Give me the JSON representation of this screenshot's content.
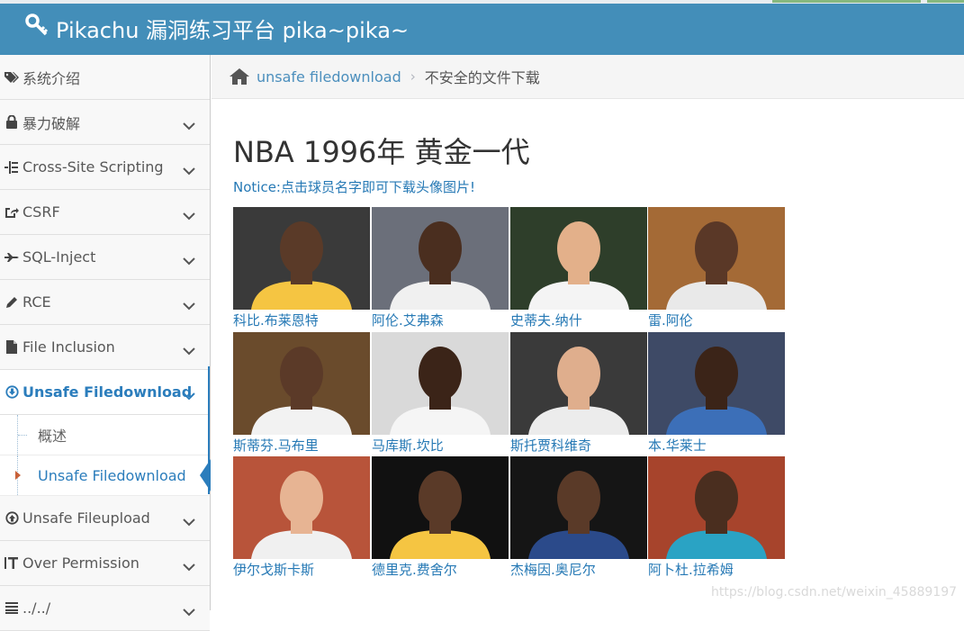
{
  "header": {
    "title": "Pikachu 漏洞练习平台 pika~pika~"
  },
  "sidebar": {
    "items": [
      {
        "label": "系统介绍",
        "icon": "tags-icon",
        "chevron": false
      },
      {
        "label": "暴力破解",
        "icon": "lock-icon",
        "chevron": true
      },
      {
        "label": "Cross-Site Scripting",
        "icon": "sitemap-icon",
        "chevron": true
      },
      {
        "label": "CSRF",
        "icon": "share-square-icon",
        "chevron": true
      },
      {
        "label": "SQL-Inject",
        "icon": "fighter-jet-icon",
        "chevron": true
      },
      {
        "label": "RCE",
        "icon": "pencil-icon",
        "chevron": true
      },
      {
        "label": "File Inclusion",
        "icon": "file-icon",
        "chevron": true
      },
      {
        "label": "Unsafe Filedownload",
        "icon": "download-circle-icon",
        "chevron": true
      },
      {
        "label": "Unsafe Fileupload",
        "icon": "upload-circle-icon",
        "chevron": true
      },
      {
        "label": "Over Permission",
        "icon": "text-height-icon",
        "chevron": true
      },
      {
        "label": "../../",
        "icon": "align-justify-icon",
        "chevron": true
      }
    ],
    "subitems": [
      {
        "label": "概述"
      },
      {
        "label": "Unsafe Filedownload"
      }
    ]
  },
  "breadcrumb": {
    "link": "unsafe filedownload",
    "current": "不安全的文件下载"
  },
  "main": {
    "title": "NBA 1996年 黄金一代",
    "notice": "Notice:点击球员名字即可下载头像图片!",
    "players": [
      {
        "name": "科比.布莱恩特",
        "bg": "#3a3a3a",
        "skin": "#5a3a28",
        "jersey": "#f5c542"
      },
      {
        "name": "阿伦.艾弗森",
        "bg": "#6b6f7a",
        "skin": "#4a2e1f",
        "jersey": "#f0f0f0"
      },
      {
        "name": "史蒂夫.纳什",
        "bg": "#2e3e2a",
        "skin": "#e3b08a",
        "jersey": "#f4f4f4"
      },
      {
        "name": "雷.阿伦",
        "bg": "#a46a36",
        "skin": "#5a3827",
        "jersey": "#e9e9e9"
      },
      {
        "name": "斯蒂芬.马布里",
        "bg": "#6a4b2c",
        "skin": "#5b3a28",
        "jersey": "#f2f2f2"
      },
      {
        "name": "马库斯.坎比",
        "bg": "#d9d9d9",
        "skin": "#3b2418",
        "jersey": "#f5f5f5"
      },
      {
        "name": "斯托贾科维奇",
        "bg": "#3a3a3a",
        "skin": "#dfae8d",
        "jersey": "#ececec"
      },
      {
        "name": "本.华莱士",
        "bg": "#3e4a66",
        "skin": "#3b2418",
        "jersey": "#3c6fb8"
      },
      {
        "name": "伊尔戈斯卡斯",
        "bg": "#b8543a",
        "skin": "#e7b493",
        "jersey": "#f0f0f0"
      },
      {
        "name": "德里克.费舍尔",
        "bg": "#111111",
        "skin": "#5a3a28",
        "jersey": "#f5c542"
      },
      {
        "name": "杰梅因.奥尼尔",
        "bg": "#151515",
        "skin": "#5a3a28",
        "jersey": "#2b4a8a"
      },
      {
        "name": "阿卜杜.拉希姆",
        "bg": "#a7442c",
        "skin": "#4a2e1f",
        "jersey": "#2aa3c4"
      }
    ]
  },
  "watermark": "https://blog.csdn.net/weixin_45889197",
  "colors": {
    "header": "#438eb9",
    "link": "#2679b5",
    "active": "#2b7dbc"
  }
}
